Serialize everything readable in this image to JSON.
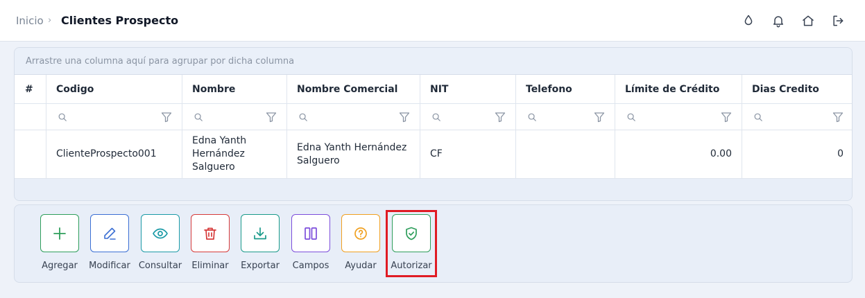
{
  "breadcrumb": {
    "home": "Inicio",
    "separator": "›",
    "current": "Clientes Prospecto"
  },
  "header_icons": [
    "water-drop-icon",
    "bell-icon",
    "home-icon",
    "logout-icon"
  ],
  "grid": {
    "group_panel_text": "Arrastre una columna aquí para agrupar por dicha columna",
    "columns": [
      "#",
      "Codigo",
      "Nombre",
      "Nombre Comercial",
      "NIT",
      "Telefono",
      "Límite de Crédito",
      "Dias Credito"
    ],
    "rows": [
      {
        "index": "",
        "codigo": "ClienteProspecto001",
        "nombre": "Edna Yanth Hernández Salguero",
        "nombre_comercial": "Edna Yanth Hernández Salguero",
        "nit": "CF",
        "telefono": "",
        "limite_credito": "0.00",
        "dias_credito": "0"
      }
    ]
  },
  "toolbar": [
    {
      "label": "Agregar",
      "icon": "plus-icon",
      "color": "#2e9e5b"
    },
    {
      "label": "Modificar",
      "icon": "pencil-icon",
      "color": "#3b6fd4"
    },
    {
      "label": "Consultar",
      "icon": "eye-icon",
      "color": "#1a9aa6"
    },
    {
      "label": "Eliminar",
      "icon": "trash-icon",
      "color": "#d63a3a"
    },
    {
      "label": "Exportar",
      "icon": "download-icon",
      "color": "#1a9a8a"
    },
    {
      "label": "Campos",
      "icon": "columns-icon",
      "color": "#7c4ddb"
    },
    {
      "label": "Ayudar",
      "icon": "help-circle-icon",
      "color": "#f0a020"
    },
    {
      "label": "Autorizar",
      "icon": "shield-check-icon",
      "color": "#2e9e5b"
    }
  ],
  "colors": {
    "highlight": "#e01b24",
    "header_text": "#111827",
    "muted": "#8a94a3"
  }
}
